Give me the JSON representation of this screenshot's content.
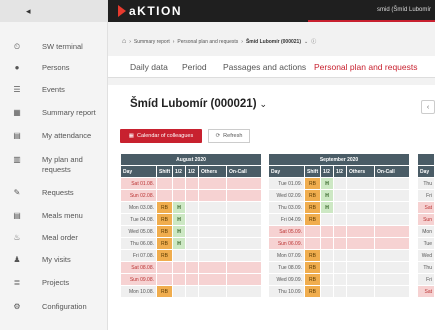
{
  "sidebar": {
    "collapse_icon": "chevron-left-icon",
    "items": [
      {
        "label": "SW terminal",
        "icon": "clock-icon",
        "glyph": "⏲"
      },
      {
        "label": "Persons",
        "icon": "person-icon",
        "glyph": "●"
      },
      {
        "label": "Events",
        "icon": "events-icon",
        "glyph": "☰"
      },
      {
        "label": "Summary report",
        "icon": "table-icon",
        "glyph": "▦"
      },
      {
        "label": "My attendance",
        "icon": "attendance-icon",
        "glyph": "▤"
      },
      {
        "label": "My plan and requests",
        "icon": "plan-icon",
        "glyph": "▥"
      },
      {
        "label": "Requests",
        "icon": "requests-icon",
        "glyph": "✎"
      },
      {
        "label": "Meals menu",
        "icon": "menu-icon",
        "glyph": "▤"
      },
      {
        "label": "Meal order",
        "icon": "cutlery-icon",
        "glyph": "♨"
      },
      {
        "label": "My visits",
        "icon": "visitors-icon",
        "glyph": "♟"
      },
      {
        "label": "Projects",
        "icon": "projects-icon",
        "glyph": "≣"
      },
      {
        "label": "Configuration",
        "icon": "gear-icon",
        "glyph": "⚙"
      }
    ]
  },
  "header": {
    "logo_text": "aKTION",
    "user": "smid (Šmíd Lubomír"
  },
  "breadcrumb": {
    "items": [
      "Summary report",
      "Personal plan and requests",
      "Šmíd Lubomír (000021)"
    ]
  },
  "tabs": [
    {
      "label": "Daily data"
    },
    {
      "label": "Period"
    },
    {
      "label": "Passages and actions"
    },
    {
      "label": "Personal plan and requests",
      "active": true
    }
  ],
  "main": {
    "person": "Šmíd Lubomír (000021)",
    "calendar_button": "Calendar of colleagues",
    "refresh_button": "Refresh"
  },
  "columns": [
    "Day",
    "Shift",
    "1/2",
    "1/2",
    "Others",
    "On-Call"
  ],
  "calendars": [
    {
      "month": "August 2020",
      "rows": [
        {
          "day": "Sat 01.08.",
          "weekend": true,
          "shift": "",
          "h1": "",
          "h2": ""
        },
        {
          "day": "Sun 02.08.",
          "weekend": true,
          "shift": "",
          "h1": "",
          "h2": ""
        },
        {
          "day": "Mon 03.08.",
          "weekend": false,
          "shift": "RB",
          "h1": "H",
          "h2": ""
        },
        {
          "day": "Tue 04.08.",
          "weekend": false,
          "shift": "RB",
          "h1": "H",
          "h2": ""
        },
        {
          "day": "Wed 05.08.",
          "weekend": false,
          "shift": "RB",
          "h1": "H",
          "h2": ""
        },
        {
          "day": "Thu 06.08.",
          "weekend": false,
          "shift": "RB",
          "h1": "H",
          "h2": ""
        },
        {
          "day": "Fri 07.08.",
          "weekend": false,
          "shift": "RB",
          "h1": "",
          "h2": ""
        },
        {
          "day": "Sat 08.08.",
          "weekend": true,
          "shift": "",
          "h1": "",
          "h2": ""
        },
        {
          "day": "Sun 09.08.",
          "weekend": true,
          "shift": "",
          "h1": "",
          "h2": ""
        },
        {
          "day": "Mon 10.08.",
          "weekend": false,
          "shift": "RB",
          "h1": "",
          "h2": ""
        }
      ]
    },
    {
      "month": "September 2020",
      "rows": [
        {
          "day": "Tue 01.09.",
          "weekend": false,
          "shift": "RB",
          "h1": "H",
          "h2": ""
        },
        {
          "day": "Wed 02.09.",
          "weekend": false,
          "shift": "RB",
          "h1": "H",
          "h2": ""
        },
        {
          "day": "Thu 03.09.",
          "weekend": false,
          "shift": "RB",
          "h1": "H",
          "h2": ""
        },
        {
          "day": "Fri 04.09.",
          "weekend": false,
          "shift": "RB",
          "h1": "",
          "h2": ""
        },
        {
          "day": "Sat 05.09.",
          "weekend": true,
          "shift": "",
          "h1": "",
          "h2": ""
        },
        {
          "day": "Sun 06.09.",
          "weekend": true,
          "shift": "",
          "h1": "",
          "h2": ""
        },
        {
          "day": "Mon 07.09.",
          "weekend": false,
          "shift": "RB",
          "h1": "",
          "h2": ""
        },
        {
          "day": "Tue 08.09.",
          "weekend": false,
          "shift": "RB",
          "h1": "",
          "h2": ""
        },
        {
          "day": "Wed 09.09.",
          "weekend": false,
          "shift": "RB",
          "h1": "",
          "h2": ""
        },
        {
          "day": "Thu 10.09.",
          "weekend": false,
          "shift": "RB",
          "h1": "",
          "h2": ""
        }
      ]
    },
    {
      "month": "",
      "rows": [
        {
          "day": "Thu",
          "weekend": false
        },
        {
          "day": "Fri",
          "weekend": false
        },
        {
          "day": "Sat",
          "weekend": true
        },
        {
          "day": "Sun",
          "weekend": true
        },
        {
          "day": "Mon",
          "weekend": false
        },
        {
          "day": "Tue",
          "weekend": false
        },
        {
          "day": "Wed",
          "weekend": false
        },
        {
          "day": "Thu",
          "weekend": false
        },
        {
          "day": "Fri",
          "weekend": false
        },
        {
          "day": "Sat",
          "weekend": true
        }
      ]
    }
  ],
  "colors": {
    "accent": "#c8212f",
    "shift": "#f0ad4e",
    "half_day": "#cde8c4",
    "weekend": "#f6d2d2",
    "table_header": "#4a5c66"
  }
}
